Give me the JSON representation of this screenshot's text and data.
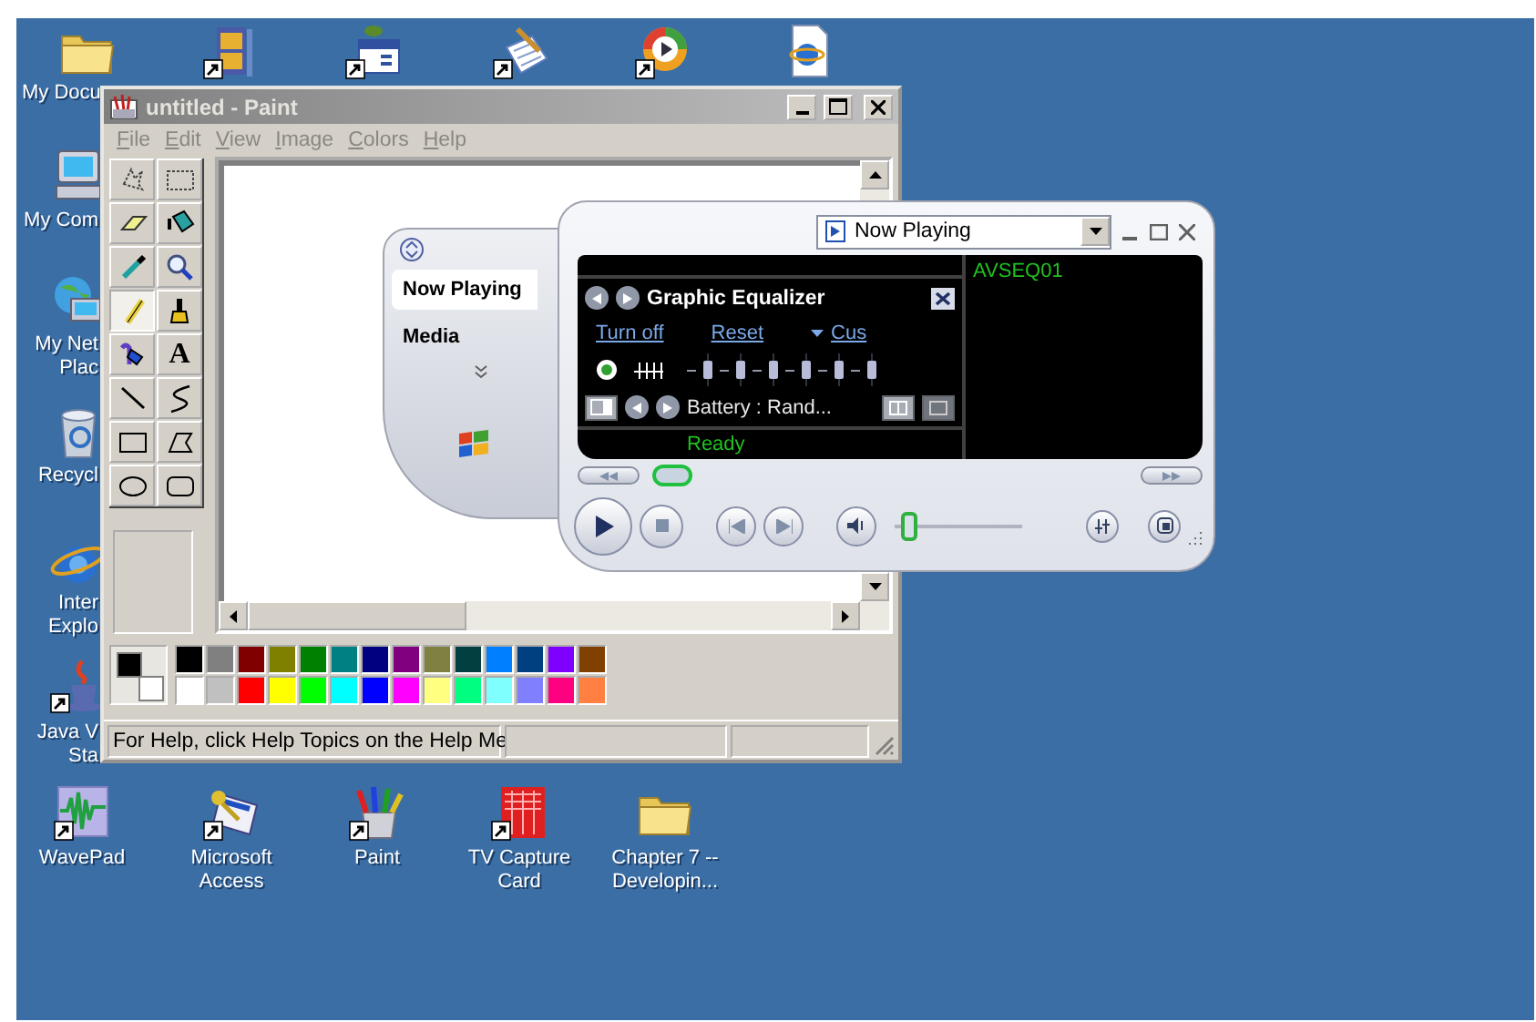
{
  "desktop": {
    "icons": [
      {
        "kind": "folder",
        "label": "My Docu"
      },
      {
        "kind": "cabinet"
      },
      {
        "kind": "calendar"
      },
      {
        "kind": "notepad"
      },
      {
        "kind": "player"
      },
      {
        "kind": "webpage"
      },
      {
        "kind": "computer",
        "label": "My Com"
      },
      {
        "kind": "network",
        "label": "My Net Plac"
      },
      {
        "kind": "recycle",
        "label": "Recycl"
      },
      {
        "kind": "globe",
        "label": "Inter Explo"
      },
      {
        "kind": "java",
        "label": "Java V Sta"
      },
      {
        "kind": "wave",
        "label": "WavePad"
      },
      {
        "kind": "access",
        "label": "Microsoft Access"
      },
      {
        "kind": "paintcup",
        "label": "Paint"
      },
      {
        "kind": "tvgrid",
        "label": "TV Capture Card"
      },
      {
        "kind": "folder",
        "label": "Chapter 7 -- Developin..."
      }
    ]
  },
  "paint": {
    "title": "untitled - Paint",
    "menu": [
      "File",
      "Edit",
      "View",
      "Image",
      "Colors",
      "Help"
    ],
    "tools": [
      {
        "kind": "free-select",
        "selected": false
      },
      {
        "kind": "select",
        "selected": false
      },
      {
        "kind": "eraser",
        "selected": false
      },
      {
        "kind": "fill",
        "selected": false
      },
      {
        "kind": "picker",
        "selected": false
      },
      {
        "kind": "magnifier",
        "selected": false
      },
      {
        "kind": "pencil",
        "selected": true
      },
      {
        "kind": "brush",
        "selected": false
      },
      {
        "kind": "airbrush",
        "selected": false
      },
      {
        "kind": "text",
        "glyph": "A",
        "selected": false
      },
      {
        "kind": "line",
        "selected": false
      },
      {
        "kind": "curve",
        "selected": false
      },
      {
        "kind": "rectangle",
        "selected": false
      },
      {
        "kind": "polygon",
        "selected": false
      },
      {
        "kind": "ellipse",
        "selected": false
      },
      {
        "kind": "rounded-rectangle",
        "selected": false
      }
    ],
    "current_colors": [
      {
        "color": "#000000"
      },
      {
        "color": "#ffffff"
      }
    ],
    "palette": [
      {
        "color": "#000000"
      },
      {
        "color": "#808080"
      },
      {
        "color": "#800000"
      },
      {
        "color": "#808000"
      },
      {
        "color": "#008000"
      },
      {
        "color": "#008080"
      },
      {
        "color": "#000080"
      },
      {
        "color": "#800080"
      },
      {
        "color": "#808040"
      },
      {
        "color": "#004040"
      },
      {
        "color": "#0080ff"
      },
      {
        "color": "#004080"
      },
      {
        "color": "#8000ff"
      },
      {
        "color": "#804000"
      },
      {
        "color": "#ffffff"
      },
      {
        "color": "#c0c0c0"
      },
      {
        "color": "#ff0000"
      },
      {
        "color": "#ffff00"
      },
      {
        "color": "#00ff00"
      },
      {
        "color": "#00ffff"
      },
      {
        "color": "#0000ff"
      },
      {
        "color": "#ff00ff"
      },
      {
        "color": "#ffff80"
      },
      {
        "color": "#00ff80"
      },
      {
        "color": "#80ffff"
      },
      {
        "color": "#8080ff"
      },
      {
        "color": "#ff0080"
      },
      {
        "color": "#ff8040"
      }
    ],
    "status": "For Help, click Help Topics on the Help Me"
  },
  "player": {
    "view": "Now Playing",
    "nav": [
      {
        "label": "Now Playing",
        "selected": true
      },
      {
        "label": "Media",
        "selected": false
      }
    ],
    "equalizer": {
      "title": "Graphic Equalizer",
      "links": [
        "Turn off",
        "Reset",
        "Cus"
      ],
      "on": true,
      "bands": [
        {
          "level": 0.5
        },
        {
          "level": 0.5
        },
        {
          "level": 0.5
        },
        {
          "level": 0.5
        },
        {
          "level": 0.5
        },
        {
          "level": 0.5
        }
      ],
      "preset": "Battery : Rand..."
    },
    "playlist": [
      "AVSEQ01"
    ],
    "status": "Ready",
    "seek": {
      "level": 0.02
    },
    "volume": {
      "level": 0.12
    }
  }
}
